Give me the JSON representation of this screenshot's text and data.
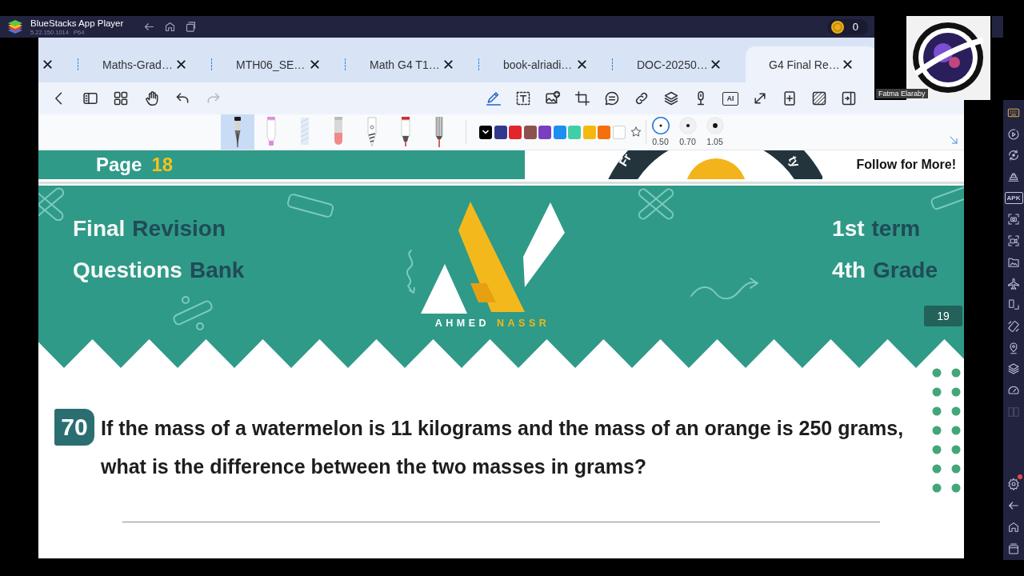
{
  "title_bar": {
    "app_name": "BlueStacks App Player",
    "version": "5.22.150.1014 P64",
    "coins": "0"
  },
  "camera_overlay": {
    "name": "Fatma Elaraby"
  },
  "tabs": [
    {
      "selected": false
    },
    {
      "label": "Maths-Grad…",
      "selected": false
    },
    {
      "label": "MTH06_SE…",
      "selected": false
    },
    {
      "label": "Math G4 T1…",
      "selected": false
    },
    {
      "label": "book-alriadi…",
      "selected": false
    },
    {
      "label": "DOC-20250…",
      "selected": false
    },
    {
      "label": "G4 Final Re…",
      "selected": true
    }
  ],
  "toolbar": {
    "left": [
      {
        "kind": "back",
        "disabled": false
      },
      {
        "kind": "panel",
        "disabled": false
      },
      {
        "kind": "grid",
        "disabled": false
      },
      {
        "kind": "hand",
        "disabled": false
      },
      {
        "kind": "undo",
        "disabled": false
      },
      {
        "kind": "redo",
        "disabled": true
      }
    ],
    "right": [
      {
        "kind": "pen",
        "selected": true
      },
      {
        "kind": "textbox",
        "selected": false
      },
      {
        "kind": "image",
        "selected": false
      },
      {
        "kind": "crop",
        "selected": false
      },
      {
        "kind": "comment",
        "selected": false
      },
      {
        "kind": "link",
        "selected": false
      },
      {
        "kind": "layers",
        "selected": false
      },
      {
        "kind": "mic",
        "selected": false
      },
      {
        "kind": "ai",
        "label": "AI",
        "selected": false
      },
      {
        "kind": "expand",
        "selected": false
      },
      {
        "kind": "addpage",
        "selected": false
      },
      {
        "kind": "hatch",
        "selected": false
      },
      {
        "kind": "split",
        "selected": false
      }
    ]
  },
  "pen_bar": {
    "pens": [
      {
        "kind": "fountain",
        "selected": true
      },
      {
        "kind": "highlighter",
        "selected": false
      },
      {
        "kind": "pattern",
        "selected": false
      },
      {
        "kind": "eraser",
        "selected": false
      },
      {
        "kind": "pencil",
        "selected": false
      },
      {
        "kind": "marker",
        "selected": false
      },
      {
        "kind": "fineliner",
        "selected": false
      }
    ],
    "colors": [
      {
        "color": "#000000",
        "selected": true
      },
      {
        "color": "#33388f",
        "selected": false
      },
      {
        "color": "#e0262b",
        "selected": false
      },
      {
        "color": "#8b524f",
        "selected": false
      },
      {
        "color": "#7a3fc1",
        "selected": false
      },
      {
        "color": "#1d8ff0",
        "selected": false
      },
      {
        "color": "#42cfa7",
        "selected": false
      },
      {
        "color": "#f4b80f",
        "selected": false
      },
      {
        "color": "#f56f0b",
        "selected": false
      },
      {
        "color": "#ffffff",
        "selected": false
      }
    ],
    "sizes": [
      {
        "label": "0.50",
        "selected": true
      },
      {
        "label": "0.70",
        "selected": false
      },
      {
        "label": "1.05",
        "selected": false
      }
    ]
  },
  "document": {
    "top_strip": {
      "page_label": "Page",
      "page_number": "18",
      "logo_texts": [
        "Fr",
        "ty"
      ],
      "follow": "Follow for More!"
    },
    "banner": {
      "left": [
        {
          "light": "Final",
          "dark": "Revision"
        },
        {
          "light": "Questions",
          "dark": "Bank"
        }
      ],
      "logo": {
        "first": "AHMED",
        "second": "NASSR"
      },
      "right": [
        {
          "light": "1st",
          "dark": "term"
        },
        {
          "light": "4th",
          "dark": "Grade"
        }
      ],
      "page_badge": "19"
    },
    "question": {
      "number": "70",
      "text": "If the mass of a watermelon is 11 kilograms and the mass of an orange is 250 grams, what is the difference between the two masses in grams?"
    }
  },
  "sidebar": {
    "top": [
      {
        "kind": "keyboard",
        "active": true,
        "disabled": false,
        "badge": false
      },
      {
        "kind": "play",
        "active": false,
        "disabled": false,
        "badge": false
      },
      {
        "kind": "sync",
        "active": false,
        "disabled": false,
        "badge": false
      },
      {
        "kind": "stack",
        "active": false,
        "disabled": false,
        "badge": false
      },
      {
        "kind": "apk",
        "label": "APK",
        "active": false,
        "disabled": false,
        "badge": false
      },
      {
        "kind": "screenshot",
        "active": false,
        "disabled": false,
        "badge": false
      },
      {
        "kind": "record",
        "active": false,
        "disabled": false,
        "badge": false
      },
      {
        "kind": "folder",
        "active": false,
        "disabled": false,
        "badge": false
      },
      {
        "kind": "airplane",
        "active": false,
        "disabled": false,
        "badge": false
      },
      {
        "kind": "rotate",
        "active": false,
        "disabled": false,
        "badge": false
      },
      {
        "kind": "shake",
        "active": false,
        "disabled": false,
        "badge": false
      },
      {
        "kind": "location",
        "active": false,
        "disabled": false,
        "badge": false
      },
      {
        "kind": "layers",
        "active": false,
        "disabled": false,
        "badge": false
      },
      {
        "kind": "gauge",
        "active": false,
        "disabled": false,
        "badge": false
      },
      {
        "kind": "columns",
        "active": false,
        "disabled": true,
        "badge": false
      }
    ],
    "bottom": [
      {
        "kind": "settings",
        "active": false,
        "disabled": false,
        "badge": true
      },
      {
        "kind": "back",
        "active": false,
        "disabled": false,
        "badge": false
      },
      {
        "kind": "home",
        "active": false,
        "disabled": false,
        "badge": false
      },
      {
        "kind": "recent",
        "active": false,
        "disabled": false,
        "badge": false
      }
    ]
  }
}
